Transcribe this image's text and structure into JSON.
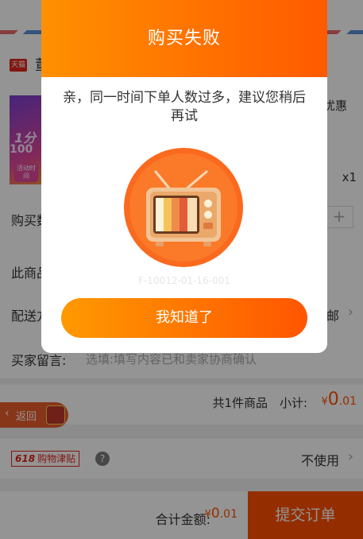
{
  "order_page": {
    "shop": {
      "badge": "天猫",
      "name_fragment": "董"
    },
    "product": {
      "thumb_line1": "1分",
      "thumb_line2": "100",
      "thumb_badge": "活动时间",
      "benefit_fragment": "优惠",
      "quantity": "x1"
    },
    "rows": {
      "buy_qty_label": "购买数",
      "plus": "+",
      "goods_label": "此商品",
      "delivery_label": "配送方",
      "delivery_value": "邮",
      "note_label": "买家留言:",
      "note_placeholder": "选填:填写内容已和卖家协商确认"
    },
    "subtotal": {
      "count": "共1件商品",
      "label": "小计:",
      "currency": "¥",
      "int": "0",
      "dec": ".01"
    },
    "back_button": {
      "label": "返回"
    },
    "subsidy": {
      "badge_num": "618",
      "badge_text": "购物津贴",
      "help": "?",
      "value": "不使用"
    },
    "footer": {
      "total_label": "合计金额:",
      "currency": "¥",
      "int": "0",
      "dec": ".01",
      "submit": "提交订单"
    }
  },
  "modal": {
    "title": "购买失败",
    "message": "亲，同一时间下单人数过多，建议您稍后再试",
    "error_code": "F-10012-01-16-001",
    "button": "我知道了"
  },
  "colors": {
    "accent": "#ff5000",
    "modal_gradient_start": "#ff9000",
    "modal_gradient_end": "#ff5a00"
  }
}
